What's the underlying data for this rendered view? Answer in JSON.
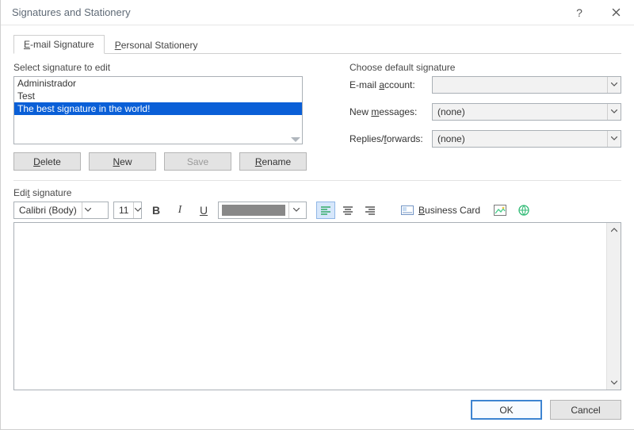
{
  "window": {
    "title": "Signatures and Stationery"
  },
  "tabs": {
    "email": "E-mail Signature",
    "stationery": "Personal Stationery"
  },
  "left": {
    "section_label": "Select signature to edit",
    "items": [
      "Administrador",
      "Test",
      "The best signature in the world!"
    ],
    "selected_index": 2,
    "buttons": {
      "delete": "Delete",
      "new": "New",
      "save": "Save",
      "rename": "Rename"
    }
  },
  "right": {
    "section_label": "Choose default signature",
    "email_label": "E-mail account:",
    "email_value_redacted": true,
    "new_msg_label": "New messages:",
    "new_msg_value": "(none)",
    "replies_label": "Replies/forwards:",
    "replies_value": "(none)"
  },
  "editor": {
    "label": "Edit signature",
    "font": "Calibri (Body)",
    "size": "11",
    "bold": "B",
    "italic": "I",
    "underline": "U",
    "color": "#888888",
    "alignment": "left",
    "business_card": "Business Card"
  },
  "footer": {
    "ok": "OK",
    "cancel": "Cancel"
  }
}
